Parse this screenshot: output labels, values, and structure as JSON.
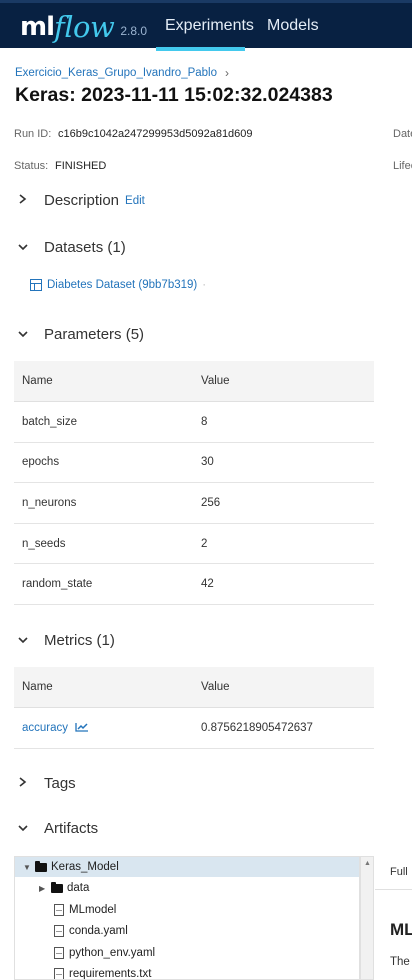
{
  "header": {
    "logo_ml": "ml",
    "logo_flow": "flow",
    "version": "2.8.0",
    "nav": [
      {
        "label": "Experiments",
        "active": true
      },
      {
        "label": "Models",
        "active": false
      }
    ],
    "bg_color": "#082142",
    "accent_color": "#43c9ed"
  },
  "breadcrumb": {
    "experiment": "Exercicio_Keras_Grupo_Ivandro_Pablo",
    "separator": "›"
  },
  "page_title": "Keras: 2023-11-11 15:02:32.024383",
  "meta": {
    "run_id_label": "Run ID:",
    "run_id_value": "c16b9c1042a247299953d5092a81d609",
    "date_label_cut": "Date",
    "status_label": "Status:",
    "status_value": "FINISHED",
    "lifecycle_label_cut": "Lifec"
  },
  "sections": {
    "description": {
      "title": "Description",
      "edit": "Edit",
      "icon": "chevron-right-icon"
    },
    "datasets": {
      "title": "Datasets (1)",
      "icon": "chevron-down-icon"
    },
    "parameters": {
      "title": "Parameters (5)",
      "icon": "chevron-down-icon"
    },
    "metrics": {
      "title": "Metrics (1)",
      "icon": "chevron-down-icon"
    },
    "tags": {
      "title": "Tags",
      "icon": "chevron-right-icon"
    },
    "artifacts": {
      "title": "Artifacts",
      "icon": "chevron-down-icon"
    }
  },
  "dataset": {
    "name": "Diabetes Dataset (9bb7b319)",
    "icon": "table-icon"
  },
  "parameters": {
    "headers": [
      "Name",
      "Value"
    ],
    "rows": [
      [
        "batch_size",
        "8"
      ],
      [
        "epochs",
        "30"
      ],
      [
        "n_neurons",
        "256"
      ],
      [
        "n_seeds",
        "2"
      ],
      [
        "random_state",
        "42"
      ]
    ]
  },
  "metrics": {
    "headers": [
      "Name",
      "Value"
    ],
    "rows": [
      [
        "accuracy",
        "0.8756218905472637"
      ]
    ],
    "trend_icon": "line-chart-icon"
  },
  "artifacts": {
    "tree": [
      {
        "name": "Keras_Model",
        "type": "folder",
        "expanded": true,
        "selected": true
      },
      {
        "name": "data",
        "type": "folder",
        "expanded": false
      },
      {
        "name": "MLmodel",
        "type": "file"
      },
      {
        "name": "conda.yaml",
        "type": "file"
      },
      {
        "name": "python_env.yaml",
        "type": "file"
      },
      {
        "name": "requirements.txt",
        "type": "file"
      }
    ],
    "preview_tab_cut": "Full",
    "preview_title_cut": "ML",
    "preview_text_cut": "The"
  }
}
